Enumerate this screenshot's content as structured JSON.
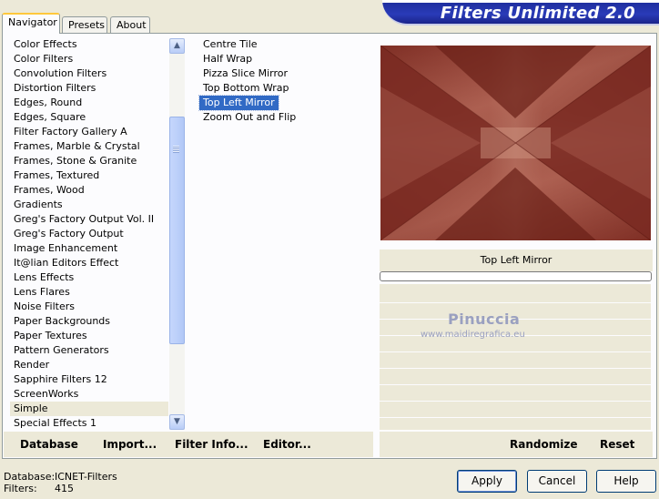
{
  "tabs": [
    {
      "label": "Navigator",
      "active": true
    },
    {
      "label": "Presets",
      "active": false
    },
    {
      "label": "About",
      "active": false
    }
  ],
  "banner_title": "Filters Unlimited 2.0",
  "categories": [
    "Color Effects",
    "Color Filters",
    "Convolution Filters",
    "Distortion Filters",
    "Edges, Round",
    "Edges, Square",
    "Filter Factory Gallery A",
    "Frames, Marble & Crystal",
    "Frames, Stone & Granite",
    "Frames, Textured",
    "Frames, Wood",
    "Gradients",
    "Greg's Factory Output Vol. II",
    "Greg's Factory Output",
    "Image Enhancement",
    "It@lian Editors Effect",
    "Lens Effects",
    "Lens Flares",
    "Noise Filters",
    "Paper Backgrounds",
    "Paper Textures",
    "Pattern Generators",
    "Render",
    "Sapphire Filters 12",
    "ScreenWorks",
    "Simple",
    "Special Effects 1"
  ],
  "selected_category": "Simple",
  "filters": [
    "Centre Tile",
    "Half Wrap",
    "Pizza Slice Mirror",
    "Top Bottom Wrap",
    "Top Left Mirror",
    "Zoom Out and Flip"
  ],
  "selected_filter": "Top Left Mirror",
  "preview_caption": "Top Left Mirror",
  "watermark": {
    "name": "Pinuccia",
    "url": "www.maidiregrafica.eu"
  },
  "bottom_buttons": {
    "database": "Database",
    "import": "Import...",
    "filter_info": "Filter Info...",
    "editor": "Editor...",
    "randomize": "Randomize",
    "reset": "Reset"
  },
  "footer": {
    "database_label": "Database:",
    "database_value": "ICNET-Filters",
    "filters_label": "Filters:",
    "filters_value": "415",
    "apply": "Apply",
    "cancel": "Cancel",
    "help": "Help"
  },
  "colors": {
    "accent_tab": "#ffc83c",
    "selection": "#316ac5",
    "banner": "#1c2c9a",
    "preview_base": "#7a2a22"
  }
}
